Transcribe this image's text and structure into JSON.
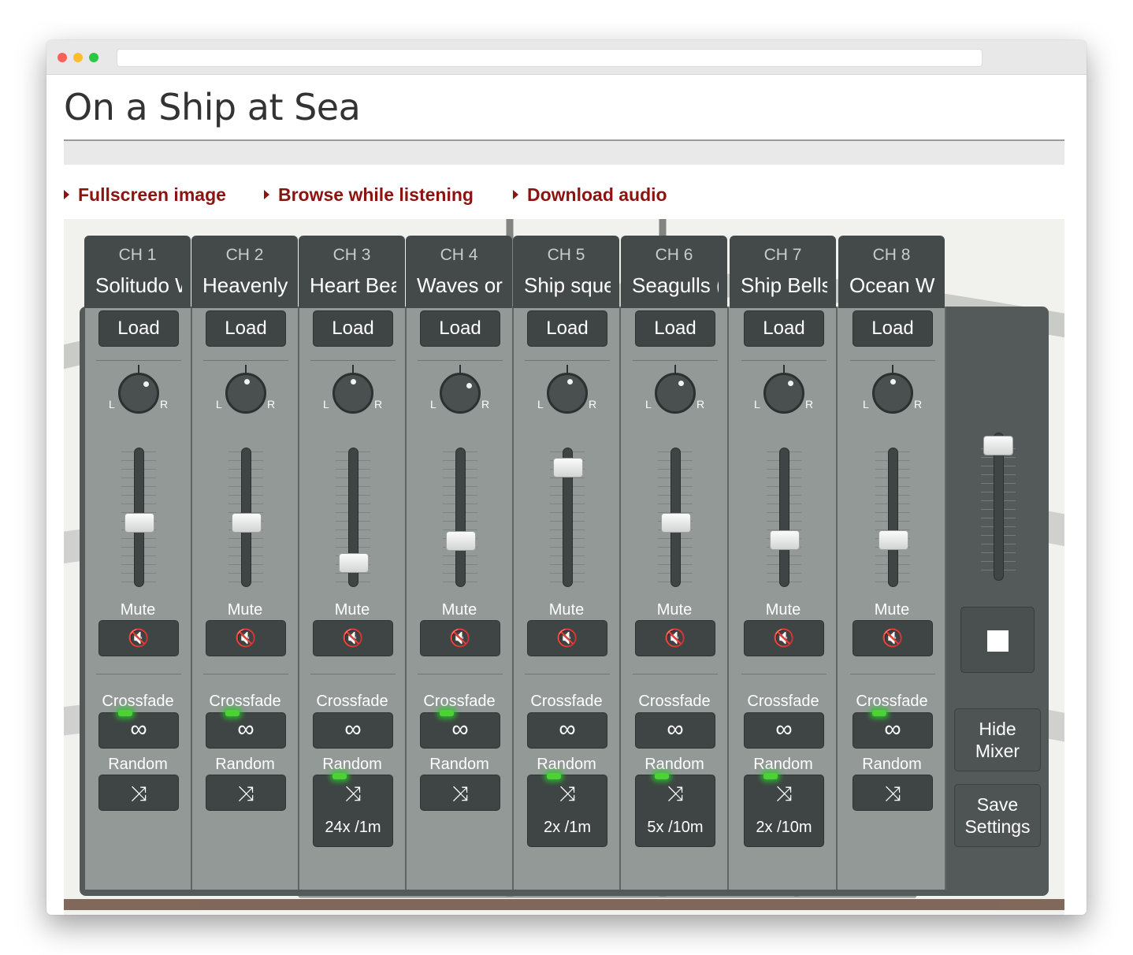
{
  "browser": {
    "address": ""
  },
  "page": {
    "title": "On a Ship at Sea",
    "links": [
      {
        "label": "Fullscreen image"
      },
      {
        "label": "Browse while listening"
      },
      {
        "label": "Download audio"
      }
    ]
  },
  "mixer": {
    "channels": [
      {
        "ch": "CH 1",
        "name": "Solitudo W",
        "load": "Load",
        "pan": 0.75,
        "volume": 0.45,
        "mute_label": "Mute",
        "crossfade_label": "Crossfade",
        "crossfade_on": true,
        "random_label": "Random",
        "random_on": false,
        "random_rate": ""
      },
      {
        "ch": "CH 2",
        "name": "Heavenly",
        "load": "Load",
        "pan": 0.55,
        "volume": 0.45,
        "mute_label": "Mute",
        "crossfade_label": "Crossfade",
        "crossfade_on": true,
        "random_label": "Random",
        "random_on": false,
        "random_rate": ""
      },
      {
        "ch": "CH 3",
        "name": "Heart Bea",
        "load": "Load",
        "pan": 0.5,
        "volume": 0.15,
        "mute_label": "Mute",
        "crossfade_label": "Crossfade",
        "crossfade_on": false,
        "random_label": "Random",
        "random_on": true,
        "random_rate": "24x /1m"
      },
      {
        "ch": "CH 4",
        "name": "Waves or",
        "load": "Load",
        "pan": 0.85,
        "volume": 0.31,
        "mute_label": "Mute",
        "crossfade_label": "Crossfade",
        "crossfade_on": true,
        "random_label": "Random",
        "random_on": false,
        "random_rate": ""
      },
      {
        "ch": "CH 5",
        "name": "Ship sque",
        "load": "Load",
        "pan": 0.6,
        "volume": 0.86,
        "mute_label": "Mute",
        "crossfade_label": "Crossfade",
        "crossfade_on": false,
        "random_label": "Random",
        "random_on": true,
        "random_rate": "2x /1m"
      },
      {
        "ch": "CH 6",
        "name": "Seagulls (",
        "load": "Load",
        "pan": 0.7,
        "volume": 0.45,
        "mute_label": "Mute",
        "crossfade_label": "Crossfade",
        "crossfade_on": false,
        "random_label": "Random",
        "random_on": true,
        "random_rate": "5x /10m"
      },
      {
        "ch": "CH 7",
        "name": "Ship Bells",
        "load": "Load",
        "pan": 0.72,
        "volume": 0.32,
        "mute_label": "Mute",
        "crossfade_label": "Crossfade",
        "crossfade_on": false,
        "random_label": "Random",
        "random_on": true,
        "random_rate": "2x /10m"
      },
      {
        "ch": "CH 8",
        "name": "Ocean Wi",
        "load": "Load",
        "pan": 0.5,
        "volume": 0.32,
        "mute_label": "Mute",
        "crossfade_label": "Crossfade",
        "crossfade_on": true,
        "random_label": "Random",
        "random_on": false,
        "random_rate": ""
      }
    ],
    "master": {
      "volume": 0.95,
      "hide_label": "Hide Mixer",
      "save_label": "Save Settings"
    },
    "glyphs": {
      "pan_left": "L",
      "pan_right": "R",
      "mute": "🔇",
      "crossfade": "∞",
      "random": "⤨"
    }
  },
  "colors": {
    "link": "#8b1410",
    "mixer_bg": "#545a59",
    "led": "#4cd137"
  },
  "icons": [
    "mute-icon",
    "infinity-icon",
    "shuffle-icon",
    "stop-icon"
  ]
}
